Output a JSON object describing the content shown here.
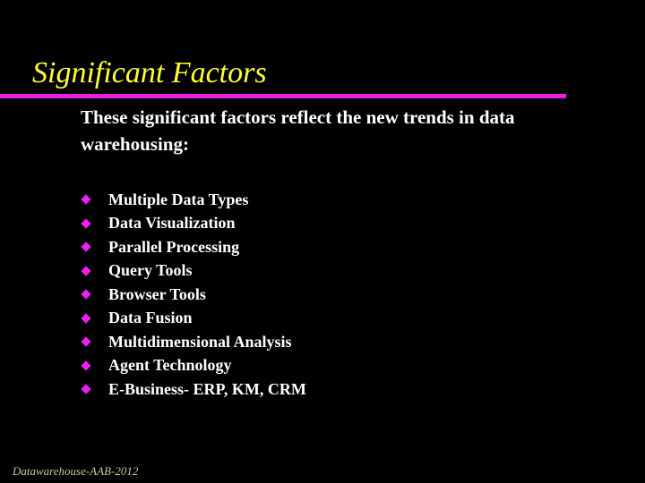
{
  "slide": {
    "title": "Significant Factors",
    "intro": "These significant factors reflect the new trends in data warehousing:",
    "bullet_icon": "diamond-bullet-icon",
    "items": [
      "Multiple Data Types",
      "Data Visualization",
      "Parallel Processing",
      "Query Tools",
      "Browser Tools",
      "Data Fusion",
      "Multidimensional Analysis",
      "Agent Technology",
      "E-Business- ERP, KM, CRM"
    ],
    "footer": "Datawarehouse-AAB-2012",
    "colors": {
      "background": "#000000",
      "title": "#ffff33",
      "rule": "#e61ee6",
      "bullet": "#f020f0",
      "text": "#ffffff",
      "footer": "#c8c890"
    }
  }
}
